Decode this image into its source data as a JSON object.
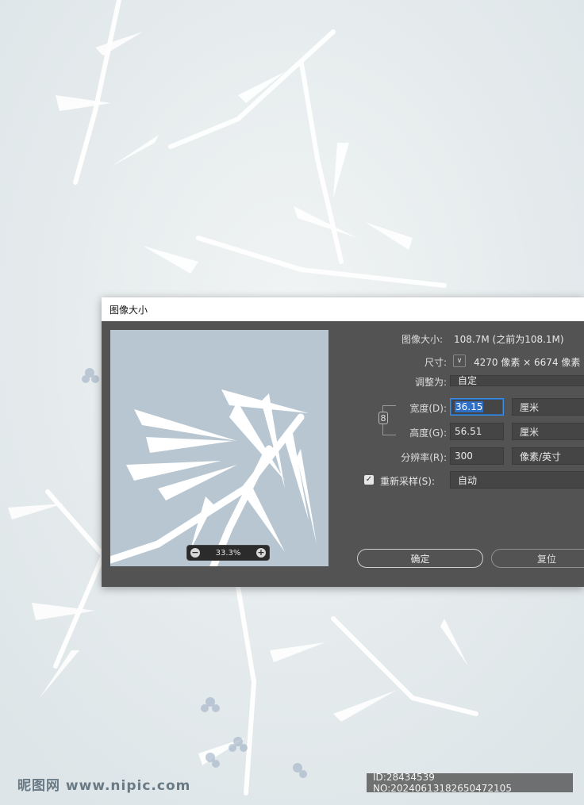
{
  "dialog": {
    "title": "图像大小",
    "zoom_level": "33.3%",
    "image_size_label": "图像大小:",
    "image_size_value": "108.7M (之前为108.1M)",
    "dimensions_label": "尺寸:",
    "dimensions_value": "4270 像素 × 6674 像素",
    "fit_to_label": "调整为:",
    "fit_to_value": "自定",
    "width_label": "宽度(D):",
    "width_value": "36.15",
    "width_unit": "厘米",
    "height_label": "高度(G):",
    "height_value": "56.51",
    "height_unit": "厘米",
    "resolution_label": "分辨率(R):",
    "resolution_value": "300",
    "resolution_unit": "像素/英寸",
    "resample_label": "重新采样(S):",
    "resample_value": "自动",
    "ok_label": "确定",
    "reset_label": "复位"
  },
  "watermark": {
    "site": "昵图网 www.nipic.com",
    "id_text": "ID:28434539 NO:20240613182650472105"
  },
  "colors": {
    "dialog_bg": "#535353",
    "accent": "#3a8ee6",
    "background": "#e9eeef"
  }
}
